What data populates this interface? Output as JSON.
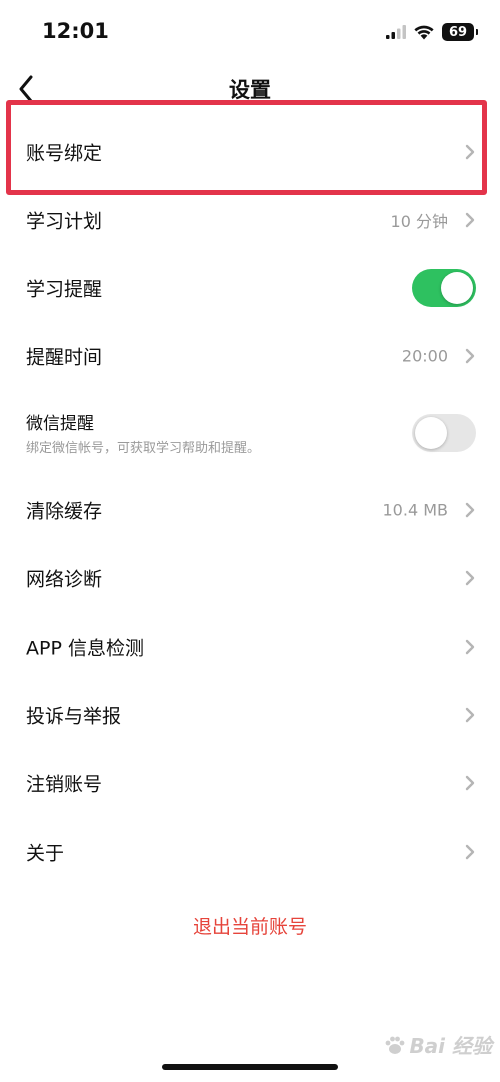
{
  "status_bar": {
    "time": "12:01",
    "battery": "69"
  },
  "nav": {
    "title": "设置"
  },
  "settings": {
    "account_binding": {
      "label": "账号绑定"
    },
    "study_plan": {
      "label": "学习计划",
      "value": "10 分钟"
    },
    "study_reminder": {
      "label": "学习提醒",
      "enabled": true
    },
    "reminder_time": {
      "label": "提醒时间",
      "value": "20:00"
    },
    "wechat_reminder": {
      "label": "微信提醒",
      "subtitle": "绑定微信帐号，可获取学习帮助和提醒。",
      "enabled": false
    },
    "clear_cache": {
      "label": "清除缓存",
      "value": "10.4 MB"
    },
    "network_diagnosis": {
      "label": "网络诊断"
    },
    "app_info_check": {
      "label": "APP 信息检测"
    },
    "complaint_report": {
      "label": "投诉与举报"
    },
    "cancel_account": {
      "label": "注销账号"
    },
    "about": {
      "label": "关于"
    }
  },
  "logout": {
    "label": "退出当前账号"
  },
  "watermark": {
    "text": "Bai 经验"
  },
  "colors": {
    "toggle_on": "#2ec160",
    "toggle_off": "#e6e6e6",
    "logout_text": "#e6443b",
    "highlight_border": "#e3344a",
    "secondary_text": "#9a9a9a"
  }
}
